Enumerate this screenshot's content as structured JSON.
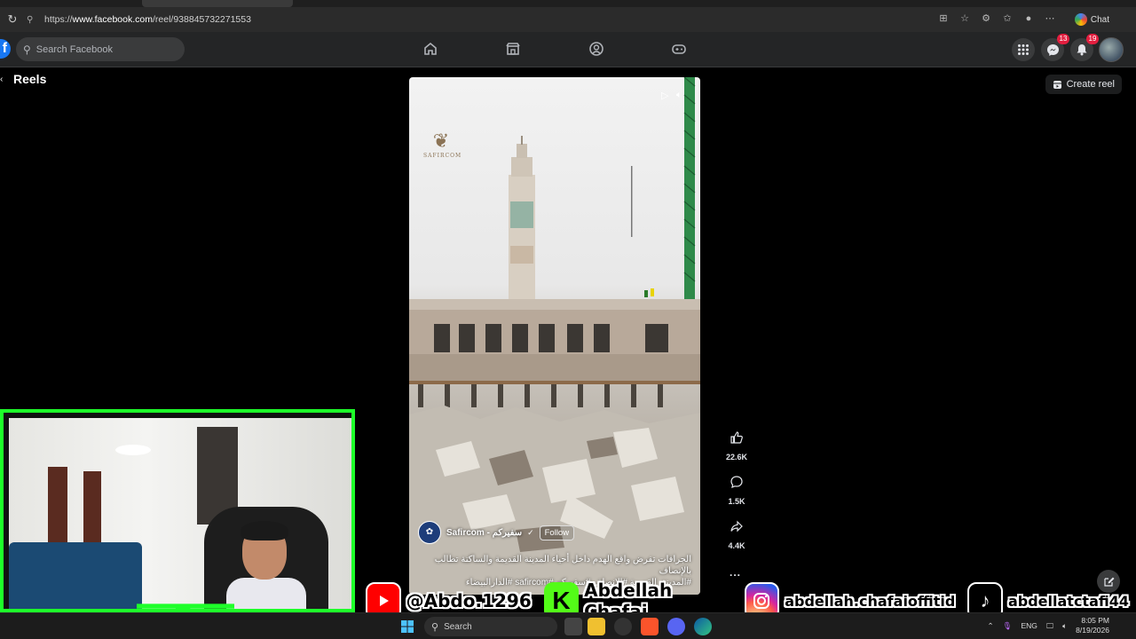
{
  "browser": {
    "url_prefix": "https://",
    "url_host": "www.facebook.com",
    "url_path": "/reel/938845732271553",
    "chat_label": "Chat"
  },
  "header": {
    "search_placeholder": "Search Facebook",
    "messenger_badge": "13",
    "notifications_badge": "19"
  },
  "page": {
    "title": "Reels",
    "create_reel_label": "Create reel"
  },
  "reel": {
    "watermark": "SAFIRCOM",
    "author_name": "Safircom - سفيركم",
    "follow_label": "Follow",
    "caption_line1": "الجرافات تفرض واقع الهدم داخل أحياء المدينة القديمة والساكنة تطالب بالإنصاف",
    "caption_line2": "#المدينة_القديمة #الإنصاف #سفيركم #safircom #الدارالبيضاء"
  },
  "actions": {
    "likes": "22.6K",
    "comments": "1.5K",
    "shares": "4.4K",
    "more": "..."
  },
  "socials": {
    "youtube": "@Abdo.1296",
    "kick": "Abdellah Chafai",
    "kick_letter": "K",
    "instagram": "abdellah.chafaioffitid",
    "tiktok": "abdellatctafi44"
  },
  "taskbar": {
    "search_label": "Search",
    "lang": "ENG",
    "time": "8:05 PM",
    "date": "8/19/2026"
  },
  "colors": {
    "facebook_blue": "#1877f2",
    "overlay_green": "#1eff2a",
    "badge_red": "#e41e3f"
  }
}
